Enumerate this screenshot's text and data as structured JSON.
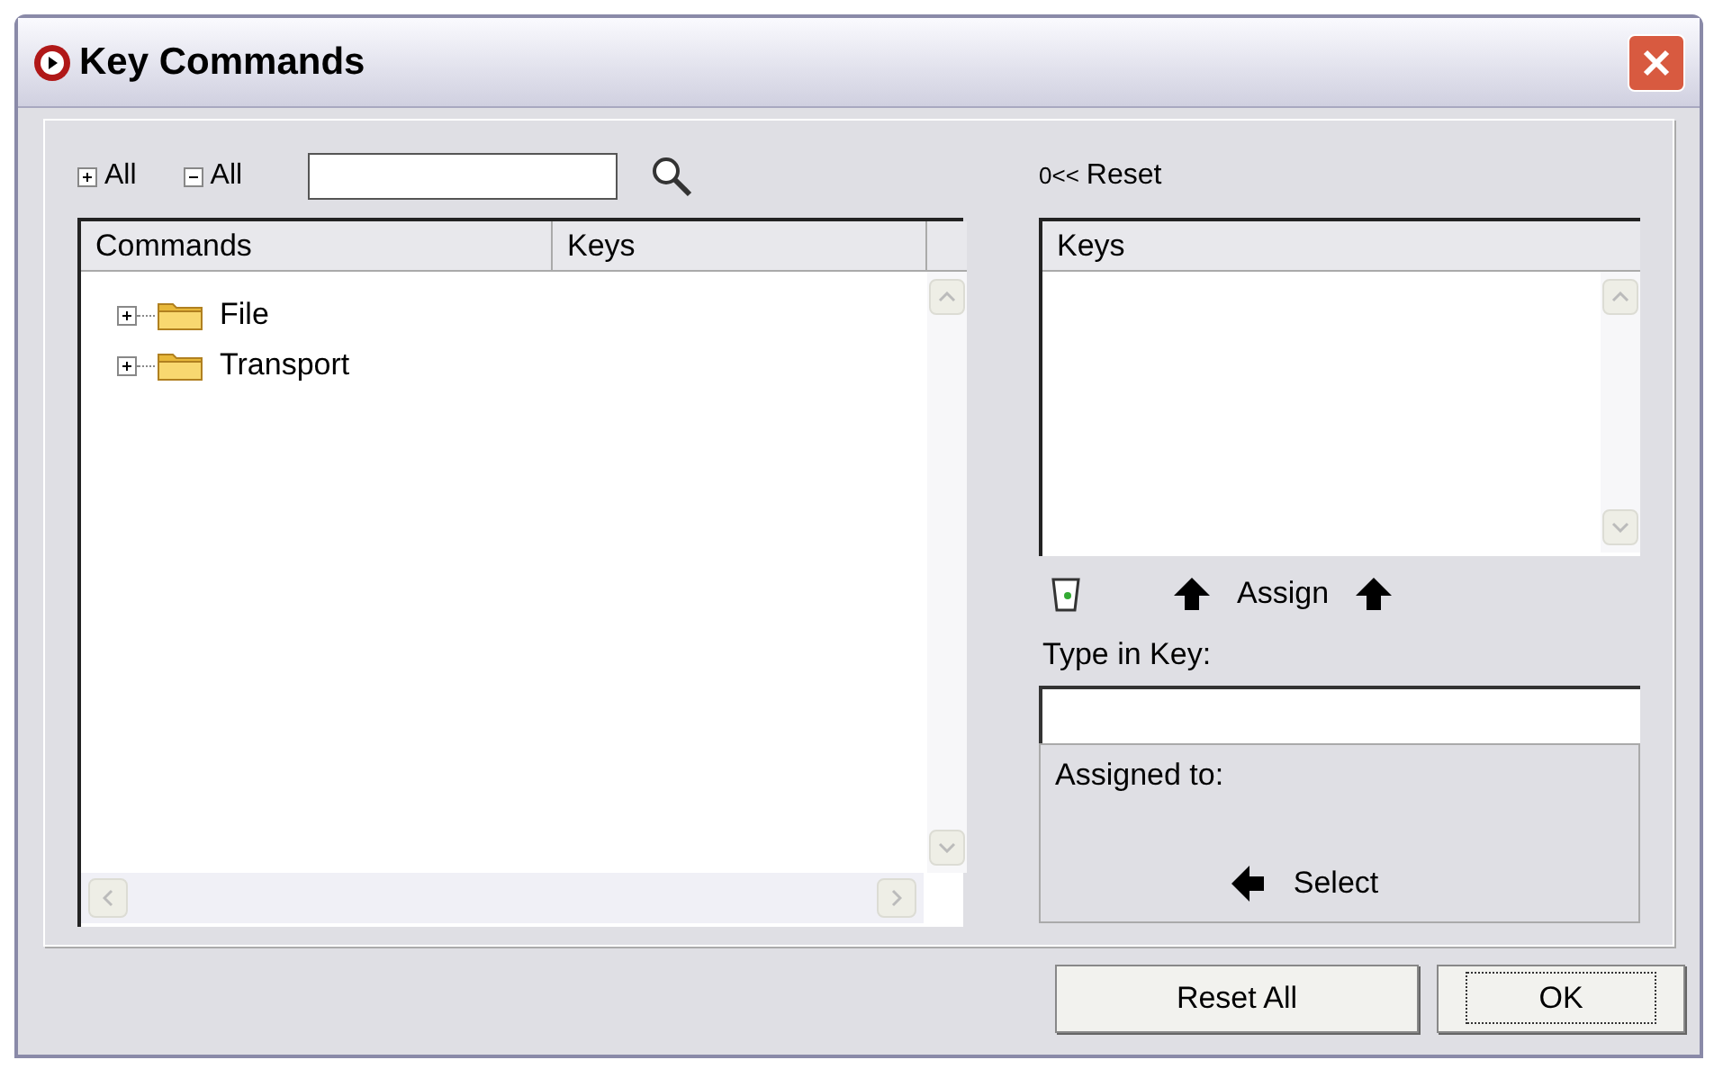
{
  "window": {
    "title": "Key Commands"
  },
  "toolbar": {
    "expand_all": "All",
    "collapse_all": "All"
  },
  "commands": {
    "columns": [
      "Commands",
      "Keys"
    ],
    "items": [
      {
        "label": "File",
        "expanded": false
      },
      {
        "label": "Transport",
        "expanded": false
      }
    ]
  },
  "reset": {
    "icon_text": "0<<",
    "label": "Reset"
  },
  "keys_list": {
    "header": "Keys"
  },
  "assign": "Assign",
  "type_in_key": {
    "label": "Type in Key:"
  },
  "assigned_to": {
    "label": "Assigned to:",
    "select": "Select"
  },
  "buttons": [
    {
      "label": "Reset All",
      "focused": false
    },
    {
      "label": "OK",
      "focused": true
    }
  ]
}
